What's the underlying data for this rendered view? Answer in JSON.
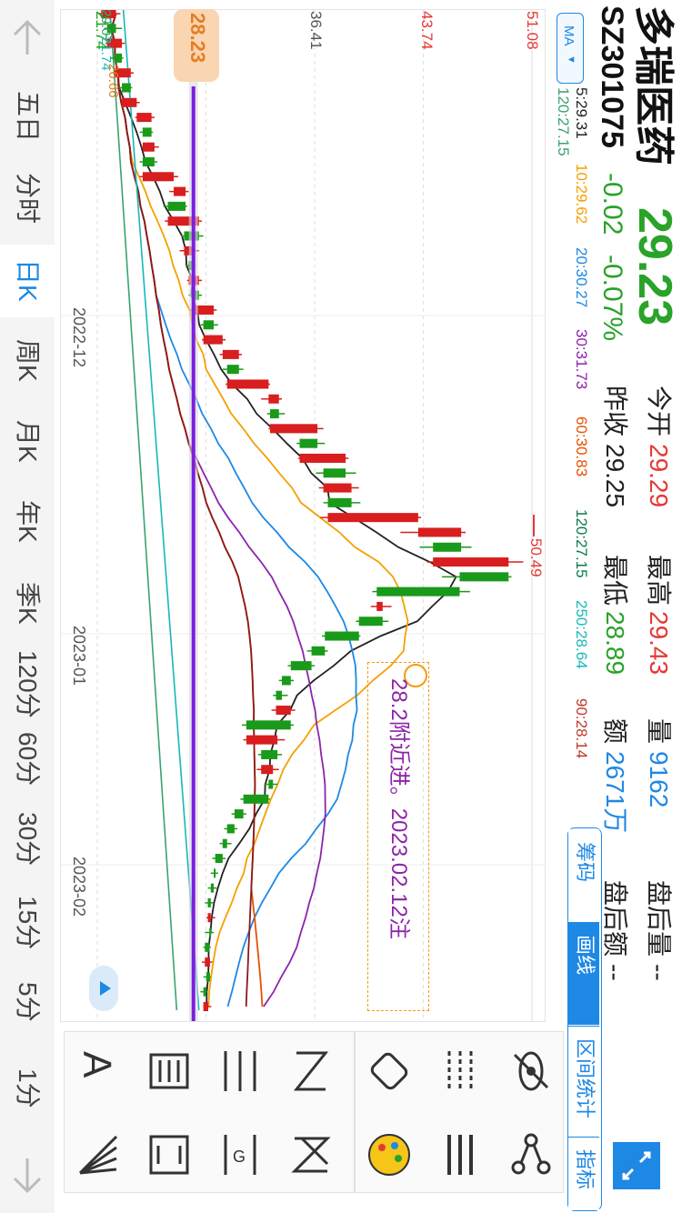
{
  "stock": {
    "name": "多瑞医药",
    "code": "SZ301075",
    "price": "29.23",
    "change": "-0.02",
    "change_pct": "-0.07%",
    "open_label": "今开",
    "open": "29.29",
    "high_label": "最高",
    "high": "29.43",
    "vol_label": "量",
    "vol": "9162",
    "after_vol_label": "盘后量",
    "after_vol": "--",
    "prev_label": "昨收",
    "prev": "29.25",
    "low_label": "最低",
    "low": "28.89",
    "amount_label": "额",
    "amount": "2671万",
    "after_amt_label": "盘后额",
    "after_amt": "--"
  },
  "ma_bar": {
    "selector": "MA",
    "items": [
      {
        "text": "5:29.31",
        "color": "#222222"
      },
      {
        "text": "10:29.62",
        "color": "#f5a000"
      },
      {
        "text": "20:30.27",
        "color": "#1e88e5"
      },
      {
        "text": "30:31.73",
        "color": "#8e24aa"
      },
      {
        "text": "60:30.83",
        "color": "#e65100"
      },
      {
        "text": "120:27.15",
        "color": "#0a7a4a"
      },
      {
        "text": "250:28.64",
        "color": "#18b8b8"
      },
      {
        "text": "90:28.14",
        "color": "#c0392b"
      }
    ],
    "extra": "120:27.15"
  },
  "timeframes": [
    "五日",
    "分时",
    "日K",
    "周K",
    "月K",
    "年K",
    "季K",
    "120分",
    "60分",
    "30分",
    "15分",
    "5分",
    "1分"
  ],
  "active_timeframe": "日K",
  "side_tabs": [
    "筹码",
    "画线",
    "区间统计",
    "指标"
  ],
  "active_side_tab": "画线",
  "chart": {
    "price_labels": [
      "51.08",
      "43.74",
      "36.41",
      "29.07",
      "21.74"
    ],
    "price_label_colors": [
      "#e53935",
      "#e53935",
      "#555555",
      "#1aa51a",
      "#1aa51a"
    ],
    "date_labels": [
      "2022-12",
      "2023-01",
      "2023-02"
    ],
    "current_price_tag": "28.23",
    "high_marker": "50.49",
    "annotation": "28.2附近进。2023.02.12注",
    "top_fragments": [
      "29.07",
      "21.74",
      "26.66"
    ]
  },
  "chart_data": {
    "type": "candlestick",
    "y_ticks": [
      51.08,
      43.74,
      36.41,
      29.07,
      21.74
    ],
    "x_ticks": [
      "2022-12",
      "2023-01",
      "2023-02"
    ],
    "horizontal_line": 28.23,
    "max_marker": 50.49,
    "candles": [
      {
        "o": 22.0,
        "c": 23.0,
        "h": 23.3,
        "l": 21.8
      },
      {
        "o": 23.0,
        "c": 22.4,
        "h": 23.4,
        "l": 22.2
      },
      {
        "o": 22.4,
        "c": 23.4,
        "h": 23.6,
        "l": 22.3
      },
      {
        "o": 23.4,
        "c": 22.9,
        "h": 23.5,
        "l": 22.6
      },
      {
        "o": 22.9,
        "c": 24.0,
        "h": 24.2,
        "l": 22.8
      },
      {
        "o": 24.0,
        "c": 23.4,
        "h": 24.1,
        "l": 23.2
      },
      {
        "o": 23.4,
        "c": 24.4,
        "h": 24.6,
        "l": 23.3
      },
      {
        "o": 24.4,
        "c": 25.4,
        "h": 25.6,
        "l": 24.3
      },
      {
        "o": 25.4,
        "c": 24.8,
        "h": 25.5,
        "l": 24.6
      },
      {
        "o": 24.8,
        "c": 25.6,
        "h": 25.9,
        "l": 24.7
      },
      {
        "o": 25.6,
        "c": 24.8,
        "h": 25.8,
        "l": 24.6
      },
      {
        "o": 24.8,
        "c": 26.9,
        "h": 27.2,
        "l": 24.6
      },
      {
        "o": 26.9,
        "c": 27.7,
        "h": 27.9,
        "l": 26.6
      },
      {
        "o": 27.7,
        "c": 26.5,
        "h": 27.8,
        "l": 26.2
      },
      {
        "o": 26.5,
        "c": 28.6,
        "h": 28.8,
        "l": 26.3
      },
      {
        "o": 28.6,
        "c": 27.6,
        "h": 28.9,
        "l": 27.4
      },
      {
        "o": 27.6,
        "c": 28.2,
        "h": 28.6,
        "l": 27.3
      },
      {
        "o": 28.2,
        "c": 27.9,
        "h": 28.4,
        "l": 27.7
      },
      {
        "o": 27.9,
        "c": 28.6,
        "h": 28.8,
        "l": 27.8
      },
      {
        "o": 28.6,
        "c": 28.1,
        "h": 28.8,
        "l": 27.9
      },
      {
        "o": 28.1,
        "c": 29.6,
        "h": 29.8,
        "l": 28.0
      },
      {
        "o": 29.6,
        "c": 28.9,
        "h": 29.9,
        "l": 28.7
      },
      {
        "o": 28.9,
        "c": 30.2,
        "h": 30.4,
        "l": 28.8
      },
      {
        "o": 30.2,
        "c": 31.3,
        "h": 31.5,
        "l": 30.0
      },
      {
        "o": 31.3,
        "c": 30.5,
        "h": 31.6,
        "l": 30.2
      },
      {
        "o": 30.5,
        "c": 33.3,
        "h": 33.4,
        "l": 30.4
      },
      {
        "o": 33.3,
        "c": 34.0,
        "h": 34.2,
        "l": 32.8
      },
      {
        "o": 34.0,
        "c": 33.4,
        "h": 34.4,
        "l": 33.2
      },
      {
        "o": 33.4,
        "c": 36.6,
        "h": 37.0,
        "l": 33.3
      },
      {
        "o": 36.6,
        "c": 35.4,
        "h": 37.1,
        "l": 35.2
      },
      {
        "o": 35.4,
        "c": 38.5,
        "h": 38.7,
        "l": 35.3
      },
      {
        "o": 38.5,
        "c": 37.0,
        "h": 39.2,
        "l": 36.5
      },
      {
        "o": 37.0,
        "c": 38.9,
        "h": 39.4,
        "l": 36.7
      },
      {
        "o": 38.9,
        "c": 37.3,
        "h": 39.5,
        "l": 37.0
      },
      {
        "o": 37.3,
        "c": 43.4,
        "h": 43.6,
        "l": 36.8
      },
      {
        "o": 43.4,
        "c": 46.3,
        "h": 46.6,
        "l": 42.2
      },
      {
        "o": 46.3,
        "c": 44.4,
        "h": 47.0,
        "l": 43.5
      },
      {
        "o": 44.4,
        "c": 49.5,
        "h": 50.49,
        "l": 44.0
      },
      {
        "o": 49.5,
        "c": 46.2,
        "h": 49.7,
        "l": 45.0
      },
      {
        "o": 46.2,
        "c": 40.6,
        "h": 46.9,
        "l": 40.3
      },
      {
        "o": 40.6,
        "c": 41.0,
        "h": 41.6,
        "l": 40.2
      },
      {
        "o": 41.0,
        "c": 39.4,
        "h": 41.4,
        "l": 39.2
      },
      {
        "o": 39.4,
        "c": 37.1,
        "h": 39.5,
        "l": 36.9
      },
      {
        "o": 37.1,
        "c": 36.2,
        "h": 37.3,
        "l": 35.9
      },
      {
        "o": 36.2,
        "c": 34.8,
        "h": 36.4,
        "l": 34.6
      },
      {
        "o": 34.8,
        "c": 34.2,
        "h": 35.0,
        "l": 34.0
      },
      {
        "o": 34.2,
        "c": 33.8,
        "h": 34.6,
        "l": 33.6
      },
      {
        "o": 33.8,
        "c": 34.8,
        "h": 35.1,
        "l": 33.5
      },
      {
        "o": 34.8,
        "c": 31.8,
        "h": 35.0,
        "l": 31.5
      },
      {
        "o": 31.8,
        "c": 33.9,
        "h": 34.4,
        "l": 31.6
      },
      {
        "o": 33.9,
        "c": 32.8,
        "h": 34.2,
        "l": 32.6
      },
      {
        "o": 32.8,
        "c": 33.6,
        "h": 34.0,
        "l": 32.5
      },
      {
        "o": 33.6,
        "c": 33.3,
        "h": 33.9,
        "l": 33.0
      },
      {
        "o": 33.3,
        "c": 31.6,
        "h": 33.4,
        "l": 31.4
      },
      {
        "o": 31.6,
        "c": 31.0,
        "h": 31.8,
        "l": 30.8
      },
      {
        "o": 31.0,
        "c": 30.5,
        "h": 31.2,
        "l": 30.3
      },
      {
        "o": 30.5,
        "c": 30.2,
        "h": 30.8,
        "l": 30.0
      },
      {
        "o": 30.2,
        "c": 29.7,
        "h": 30.4,
        "l": 29.5
      },
      {
        "o": 29.7,
        "c": 29.6,
        "h": 29.9,
        "l": 29.4
      },
      {
        "o": 29.6,
        "c": 29.4,
        "h": 29.8,
        "l": 29.2
      },
      {
        "o": 29.4,
        "c": 29.2,
        "h": 29.6,
        "l": 29.0
      },
      {
        "o": 29.2,
        "c": 29.4,
        "h": 29.7,
        "l": 29.1
      },
      {
        "o": 29.4,
        "c": 29.3,
        "h": 29.6,
        "l": 29.0
      },
      {
        "o": 29.3,
        "c": 29.0,
        "h": 29.4,
        "l": 28.9
      },
      {
        "o": 29.0,
        "c": 29.35,
        "h": 29.5,
        "l": 28.8
      },
      {
        "o": 29.35,
        "c": 29.1,
        "h": 29.4,
        "l": 28.9
      },
      {
        "o": 29.1,
        "c": 28.9,
        "h": 29.2,
        "l": 28.7
      },
      {
        "o": 28.9,
        "c": 29.23,
        "h": 29.43,
        "l": 28.89
      }
    ]
  }
}
